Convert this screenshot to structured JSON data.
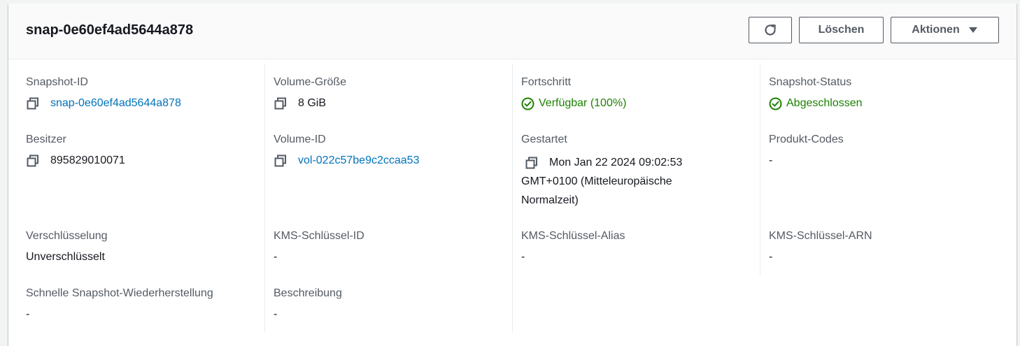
{
  "header": {
    "title": "snap-0e60ef4ad5644a878",
    "refresh_icon": "refresh-icon",
    "delete_label": "Löschen",
    "actions_label": "Aktionen"
  },
  "details": {
    "snapshot_id": {
      "label": "Snapshot-ID",
      "value": "snap-0e60ef4ad5644a878"
    },
    "volume_size": {
      "label": "Volume-Größe",
      "value": "8 GiB"
    },
    "progress": {
      "label": "Fortschritt",
      "value": "Verfügbar (100%)",
      "percent": 100
    },
    "snapshot_status": {
      "label": "Snapshot-Status",
      "value": "Abgeschlossen"
    },
    "owner": {
      "label": "Besitzer",
      "value": "895829010071"
    },
    "volume_id": {
      "label": "Volume-ID",
      "value": "vol-022c57be9c2ccaa53"
    },
    "started": {
      "label": "Gestartet",
      "value_line1": "Mon Jan 22 2024 09:02:53",
      "value_line2": "GMT+0100 (Mitteleuropäische",
      "value_line3": "Normalzeit)"
    },
    "product_codes": {
      "label": "Produkt-Codes",
      "value": "-"
    },
    "encryption": {
      "label": "Verschlüsselung",
      "value": "Unverschlüsselt"
    },
    "kms_key_id": {
      "label": "KMS-Schlüssel-ID",
      "value": "-"
    },
    "kms_key_alias": {
      "label": "KMS-Schlüssel-Alias",
      "value": "-"
    },
    "kms_key_arn": {
      "label": "KMS-Schlüssel-ARN",
      "value": "-"
    },
    "fast_restore": {
      "label": "Schnelle Snapshot-Wiederherstellung",
      "value": "-"
    },
    "description": {
      "label": "Beschreibung",
      "value": "-"
    }
  },
  "colors": {
    "link": "#0073bb",
    "success": "#1d8102",
    "label": "#545b64"
  }
}
